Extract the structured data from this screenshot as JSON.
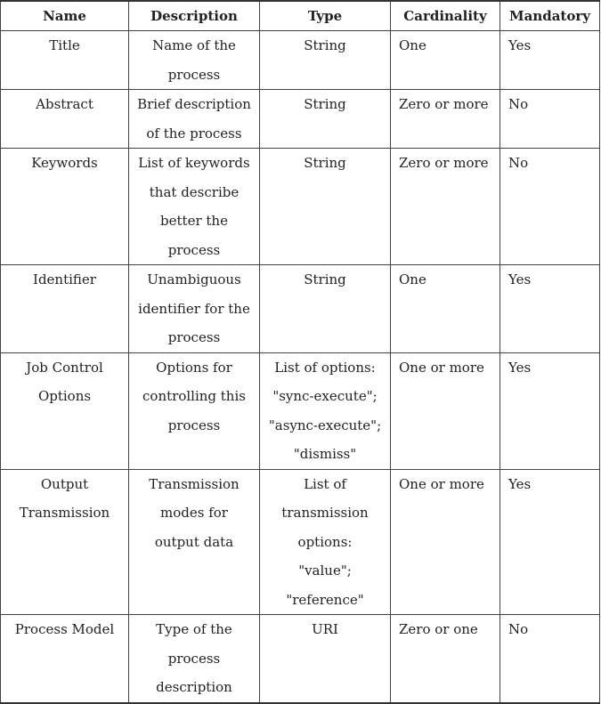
{
  "table": {
    "headers": [
      "Name",
      "Description",
      "Type",
      "Cardinality",
      "Mandatory"
    ],
    "rows": [
      {
        "name": [
          "Title"
        ],
        "description": [
          "Name of the",
          "process"
        ],
        "type": [
          "String"
        ],
        "cardinality": "One",
        "mandatory": "Yes"
      },
      {
        "name": [
          "Abstract"
        ],
        "description": [
          "Brief description",
          "of the process"
        ],
        "type": [
          "String"
        ],
        "cardinality": "Zero or more",
        "mandatory": "No"
      },
      {
        "name": [
          "Keywords"
        ],
        "description": [
          "List of keywords",
          "that describe",
          "better the",
          "process"
        ],
        "type": [
          "String"
        ],
        "cardinality": "Zero or more",
        "mandatory": "No"
      },
      {
        "name": [
          "Identifier"
        ],
        "description": [
          "Unambiguous",
          "identifier for the",
          "process"
        ],
        "type": [
          "String"
        ],
        "cardinality": "One",
        "mandatory": "Yes"
      },
      {
        "name": [
          "Job Control",
          "Options"
        ],
        "description": [
          "Options for",
          "controlling this",
          "process"
        ],
        "type": [
          "List of options:",
          "\"sync-execute\";",
          "\"async-execute\";",
          "\"dismiss\""
        ],
        "cardinality": "One or more",
        "mandatory": "Yes"
      },
      {
        "name": [
          "Output",
          "Transmission"
        ],
        "description": [
          "Transmission",
          "modes for",
          "output data"
        ],
        "type": [
          "List of",
          "transmission",
          "options:",
          "\"value\";",
          "\"reference\""
        ],
        "cardinality": "One or more",
        "mandatory": "Yes"
      },
      {
        "name": [
          "Process Model"
        ],
        "description": [
          "Type of the",
          "process",
          "description"
        ],
        "type": [
          "URI"
        ],
        "cardinality": "Zero or one",
        "mandatory": "No"
      }
    ]
  }
}
